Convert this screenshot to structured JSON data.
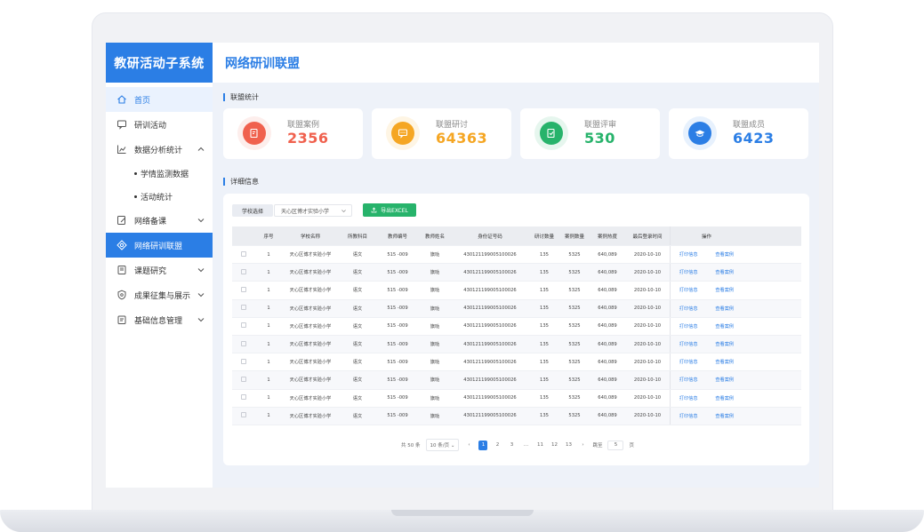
{
  "app": {
    "brand": "教研活动子系统",
    "page_title": "网络研训联盟"
  },
  "sidebar": {
    "items": [
      {
        "label": "首页",
        "icon": "home-icon"
      },
      {
        "label": "研训活动",
        "icon": "chat-icon"
      },
      {
        "label": "数据分析统计",
        "icon": "chart-icon"
      },
      {
        "label": "网络备课",
        "icon": "edit-icon"
      },
      {
        "label": "网络研训联盟",
        "icon": "network-icon"
      },
      {
        "label": "课题研究",
        "icon": "book-icon"
      },
      {
        "label": "成果征集与展示",
        "icon": "shield-icon"
      },
      {
        "label": "基础信息管理",
        "icon": "clipboard-icon"
      }
    ],
    "subitems": [
      "学情监测数据",
      "活动统计"
    ]
  },
  "stats": {
    "section_label": "联盟统计",
    "cards": [
      {
        "label": "联盟案例",
        "value": "2356",
        "color": "#f0614e",
        "icon": "document-edit-icon"
      },
      {
        "label": "联盟研讨",
        "value": "64363",
        "color": "#f5a623",
        "icon": "message-icon"
      },
      {
        "label": "联盟评审",
        "value": "530",
        "color": "#27b36b",
        "icon": "review-icon"
      },
      {
        "label": "联盟成员",
        "value": "6423",
        "color": "#2b7ee5",
        "icon": "graduation-cap-icon"
      }
    ]
  },
  "detail": {
    "section_label": "详细信息",
    "filter_label": "学校选择",
    "filter_value": "天心区博才实验小学",
    "export_label": "导出EXCEL",
    "columns": [
      "",
      "序号",
      "学校名称",
      "所教科目",
      "教师编号",
      "教师姓名",
      "身份证号码",
      "研讨数量",
      "案例数量",
      "案例热度",
      "最后登录时间",
      "操作"
    ],
    "rows": [
      [
        "1",
        "天心区博才实验小学",
        "语文",
        "515 -009",
        "旗哒",
        "430121199005100026",
        "135",
        "5325",
        "640,089",
        "2020-10-10"
      ],
      [
        "1",
        "天心区博才实验小学",
        "语文",
        "515 -009",
        "旗哒",
        "430121199005100026",
        "135",
        "5325",
        "640,089",
        "2020-10-10"
      ],
      [
        "1",
        "天心区博才实验小学",
        "语文",
        "515 -009",
        "旗哒",
        "430121199005100026",
        "135",
        "5325",
        "640,089",
        "2020-10-10"
      ],
      [
        "1",
        "天心区博才实验小学",
        "语文",
        "515 -009",
        "旗哒",
        "430121199005100026",
        "135",
        "5325",
        "640,089",
        "2020-10-10"
      ],
      [
        "1",
        "天心区博才实验小学",
        "语文",
        "515 -009",
        "旗哒",
        "430121199005100026",
        "135",
        "5325",
        "640,089",
        "2020-10-10"
      ],
      [
        "1",
        "天心区博才实验小学",
        "语文",
        "515 -009",
        "旗哒",
        "430121199005100026",
        "135",
        "5325",
        "640,089",
        "2020-10-10"
      ],
      [
        "1",
        "天心区博才实验小学",
        "语文",
        "515 -009",
        "旗哒",
        "430121199005100026",
        "135",
        "5325",
        "640,089",
        "2020-10-10"
      ],
      [
        "1",
        "天心区博才实验小学",
        "语文",
        "515 -009",
        "旗哒",
        "430121199005100026",
        "135",
        "5325",
        "640,089",
        "2020-10-10"
      ],
      [
        "1",
        "天心区博才实验小学",
        "语文",
        "515 -009",
        "旗哒",
        "430121199005100026",
        "135",
        "5325",
        "640,089",
        "2020-10-10"
      ],
      [
        "1",
        "天心区博才实验小学",
        "语文",
        "515 -009",
        "旗哒",
        "430121199005100026",
        "135",
        "5325",
        "640,089",
        "2020-10-10"
      ]
    ],
    "action_print": "打印信息",
    "action_view": "查看案例"
  },
  "pagination": {
    "total": "共 50 条",
    "page_size": "10 条/页",
    "pages": [
      "1",
      "2",
      "3",
      "...",
      "11",
      "12",
      "13"
    ],
    "current": "1",
    "jump_label": "跳至",
    "jump_value": "5",
    "page_suffix": "页"
  },
  "colors": {
    "primary": "#2b7ee5",
    "success": "#27b36b"
  }
}
